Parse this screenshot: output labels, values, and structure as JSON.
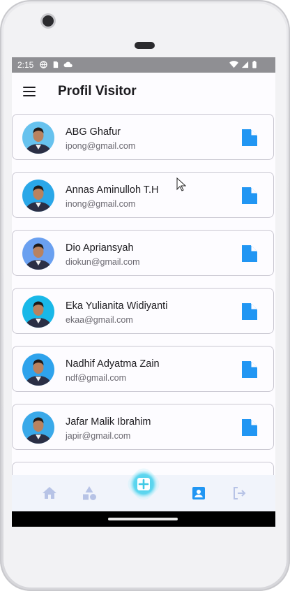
{
  "status": {
    "time": "2:15"
  },
  "appbar": {
    "title": "Profil Visitor"
  },
  "visitors": [
    {
      "name": "ABG Ghafur",
      "email": "ipong@gmail.com"
    },
    {
      "name": "Annas Aminulloh T.H",
      "email": "inong@gmail.com"
    },
    {
      "name": "Dio Apriansyah",
      "email": "diokun@gmail.com"
    },
    {
      "name": "Eka Yulianita Widiyanti",
      "email": "ekaa@gmail.com"
    },
    {
      "name": "Nadhif Adyatma Zain",
      "email": "ndf@gmail.com"
    },
    {
      "name": "Jafar Malik Ibrahim",
      "email": "japir@gmail.com"
    }
  ],
  "icons": {
    "menu": "menu-icon",
    "doc": "document-icon",
    "home": "home-icon",
    "category": "category-icon",
    "add": "add-icon",
    "profile": "profile-icon",
    "logout": "logout-icon"
  },
  "colors": {
    "accent": "#2196f3",
    "nav_inactive": "#b7c3e6",
    "nav_active": "#2196f3",
    "status_bar": "#8f8f93"
  }
}
